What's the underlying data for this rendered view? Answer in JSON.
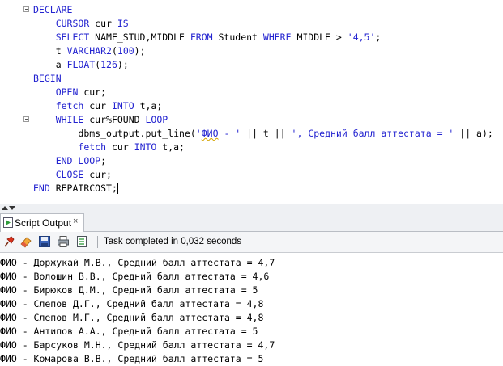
{
  "editor": {
    "lines": [
      {
        "indent": "",
        "parts": [
          {
            "t": "DECLARE",
            "c": "kw"
          }
        ]
      },
      {
        "indent": "    ",
        "parts": [
          {
            "t": "CURSOR",
            "c": "kw"
          },
          {
            "t": " cur ",
            "c": ""
          },
          {
            "t": "IS",
            "c": "kw"
          }
        ]
      },
      {
        "indent": "    ",
        "parts": [
          {
            "t": "SELECT",
            "c": "kw"
          },
          {
            "t": " NAME_STUD,MIDDLE ",
            "c": ""
          },
          {
            "t": "FROM",
            "c": "kw"
          },
          {
            "t": " Student ",
            "c": ""
          },
          {
            "t": "WHERE",
            "c": "kw"
          },
          {
            "t": " MIDDLE > ",
            "c": ""
          },
          {
            "t": "'4,5'",
            "c": "str"
          },
          {
            "t": ";",
            "c": ""
          }
        ]
      },
      {
        "indent": "    ",
        "parts": [
          {
            "t": "t ",
            "c": ""
          },
          {
            "t": "VARCHAR2",
            "c": "kw"
          },
          {
            "t": "(",
            "c": ""
          },
          {
            "t": "100",
            "c": "num"
          },
          {
            "t": ");",
            "c": ""
          }
        ]
      },
      {
        "indent": "    ",
        "parts": [
          {
            "t": "a ",
            "c": ""
          },
          {
            "t": "FLOAT",
            "c": "kw"
          },
          {
            "t": "(",
            "c": ""
          },
          {
            "t": "126",
            "c": "num"
          },
          {
            "t": ");",
            "c": ""
          }
        ]
      },
      {
        "indent": "",
        "parts": [
          {
            "t": "BEGIN",
            "c": "kw"
          }
        ]
      },
      {
        "indent": "    ",
        "parts": [
          {
            "t": "OPEN",
            "c": "kw"
          },
          {
            "t": " cur;",
            "c": ""
          }
        ]
      },
      {
        "indent": "    ",
        "parts": [
          {
            "t": "fetch",
            "c": "kw"
          },
          {
            "t": " cur ",
            "c": ""
          },
          {
            "t": "INTO",
            "c": "kw"
          },
          {
            "t": " t,a;",
            "c": ""
          }
        ]
      },
      {
        "indent": "    ",
        "parts": [
          {
            "t": "WHILE",
            "c": "kw"
          },
          {
            "t": " cur%FOUND ",
            "c": ""
          },
          {
            "t": "LOOP",
            "c": "kw"
          }
        ]
      },
      {
        "indent": "        ",
        "parts": [
          {
            "t": "dbms_output.put_line(",
            "c": ""
          },
          {
            "t": "'",
            "c": "str"
          },
          {
            "t": "ФИО",
            "c": "ru sq"
          },
          {
            "t": " - ' ",
            "c": "str"
          },
          {
            "t": "|| t || ",
            "c": ""
          },
          {
            "t": "', ",
            "c": "str"
          },
          {
            "t": "Средний балл аттестата",
            "c": "ru"
          },
          {
            "t": " = ' ",
            "c": "str"
          },
          {
            "t": "|| a);",
            "c": ""
          }
        ]
      },
      {
        "indent": "        ",
        "parts": [
          {
            "t": "fetch",
            "c": "kw"
          },
          {
            "t": " cur ",
            "c": ""
          },
          {
            "t": "INTO",
            "c": "kw"
          },
          {
            "t": " t,a;",
            "c": ""
          }
        ]
      },
      {
        "indent": "    ",
        "parts": [
          {
            "t": "END LOOP",
            "c": "kw"
          },
          {
            "t": ";",
            "c": ""
          }
        ]
      },
      {
        "indent": "    ",
        "parts": [
          {
            "t": "CLOSE",
            "c": "kw"
          },
          {
            "t": " cur;",
            "c": ""
          }
        ]
      },
      {
        "indent": "",
        "parts": [
          {
            "t": "END",
            "c": "kw"
          },
          {
            "t": " REPAIRCOST;",
            "c": ""
          }
        ]
      }
    ]
  },
  "panel": {
    "tab_label": "Script Output",
    "tab_close": "×",
    "status": "Task completed in 0,032 seconds",
    "toolbar_icons": [
      "pin-icon",
      "eraser-icon",
      "save-icon",
      "print-icon",
      "output-file-icon"
    ]
  },
  "output": {
    "lines": [
      "ФИО - Доржукай М.В., Средний балл аттестата = 4,7",
      "ФИО - Волошин В.В., Средний балл аттестата = 4,6",
      "ФИО - Бирюков Д.М., Средний балл аттестата = 5",
      "ФИО - Слепов Д.Г., Средний балл аттестата = 4,8",
      "ФИО - Слепов М.Г., Средний балл аттестата = 4,8",
      "ФИО - Антипов А.А., Средний балл аттестата = 5",
      "ФИО - Барсуков М.Н., Средний балл аттестата = 4,7",
      "ФИО - Комарова В.В., Средний балл аттестата = 5"
    ]
  },
  "colors": {
    "keyword": "#2323d0",
    "panel_bg": "#eef0f3"
  }
}
